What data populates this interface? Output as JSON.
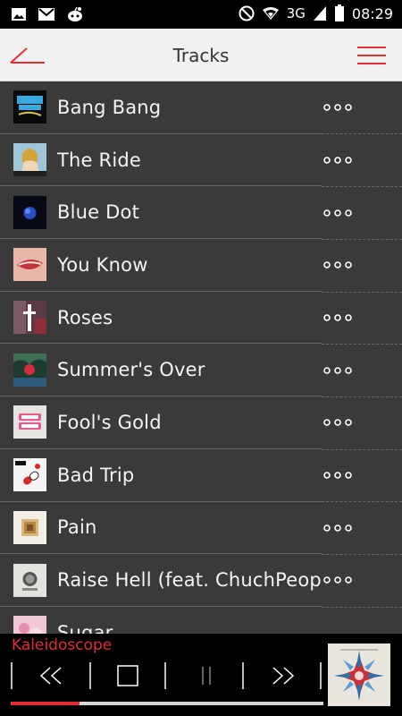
{
  "status_bar": {
    "network": "3G",
    "time": "08:29"
  },
  "header": {
    "title": "Tracks"
  },
  "tracks": [
    {
      "title": "Bang Bang",
      "art": "bang-bang-art"
    },
    {
      "title": "The Ride",
      "art": "the-ride-art"
    },
    {
      "title": "Blue Dot",
      "art": "blue-dot-art"
    },
    {
      "title": "You Know",
      "art": "you-know-art"
    },
    {
      "title": "Roses",
      "art": "roses-art"
    },
    {
      "title": "Summer's Over",
      "art": "summers-over-art"
    },
    {
      "title": "Fool's Gold",
      "art": "fools-gold-art"
    },
    {
      "title": "Bad Trip",
      "art": "bad-trip-art"
    },
    {
      "title": "Pain",
      "art": "pain-art"
    },
    {
      "title": "Raise Hell (feat. ChuchPeople)",
      "art": "raise-hell-art"
    },
    {
      "title": "Sugar",
      "art": "sugar-art"
    }
  ],
  "player": {
    "now_playing": "Kaleidoscope",
    "progress": 0.22,
    "accent": "#e32d37"
  }
}
